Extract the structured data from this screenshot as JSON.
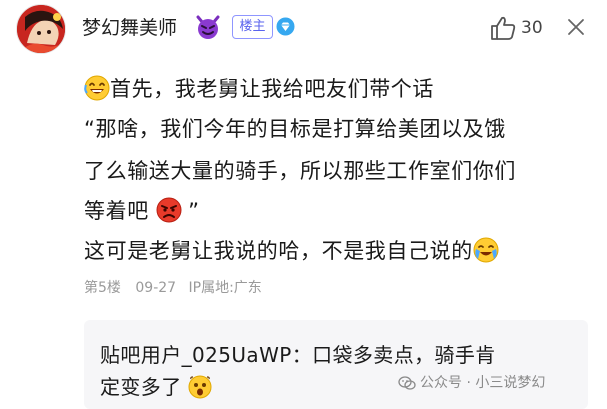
{
  "post": {
    "username": "梦幻舞美师",
    "badge": "楼主",
    "likes": "30",
    "lines": [
      "首先，我老舅让我给吧友们带个话",
      "“那啥，我们今年的目标是打算给美团以及饿",
      "了么输送大量的骑手，所以那些工作室们你们",
      "等着吧",
      "”",
      "这可是老舅让我说的哈，不是我自己说的"
    ],
    "floor": "第5楼",
    "date": "09-27",
    "ip": "IP属地:广东"
  },
  "reply": {
    "line1": "贴吧用户_025UaWP：口袋多卖点，骑手肯",
    "line2": "定变多了"
  },
  "watermark": {
    "text": "公众号 · 小三说梦幻"
  },
  "colors": {
    "badge_border": "#8f96ff",
    "badge_text": "#5a63ee",
    "level_icon": "#36a8f0",
    "meta_text": "#9a9a9a",
    "reply_bg": "#f6f6f8"
  },
  "icons": {
    "devil": "devil-icon",
    "level": "diamond-level-icon",
    "like": "thumbs-up-icon",
    "close": "close-icon",
    "grin": "grin-emoji-icon",
    "angry": "angry-emoji-icon",
    "tears": "tears-emoji-icon",
    "shock": "shocked-emoji-icon"
  }
}
